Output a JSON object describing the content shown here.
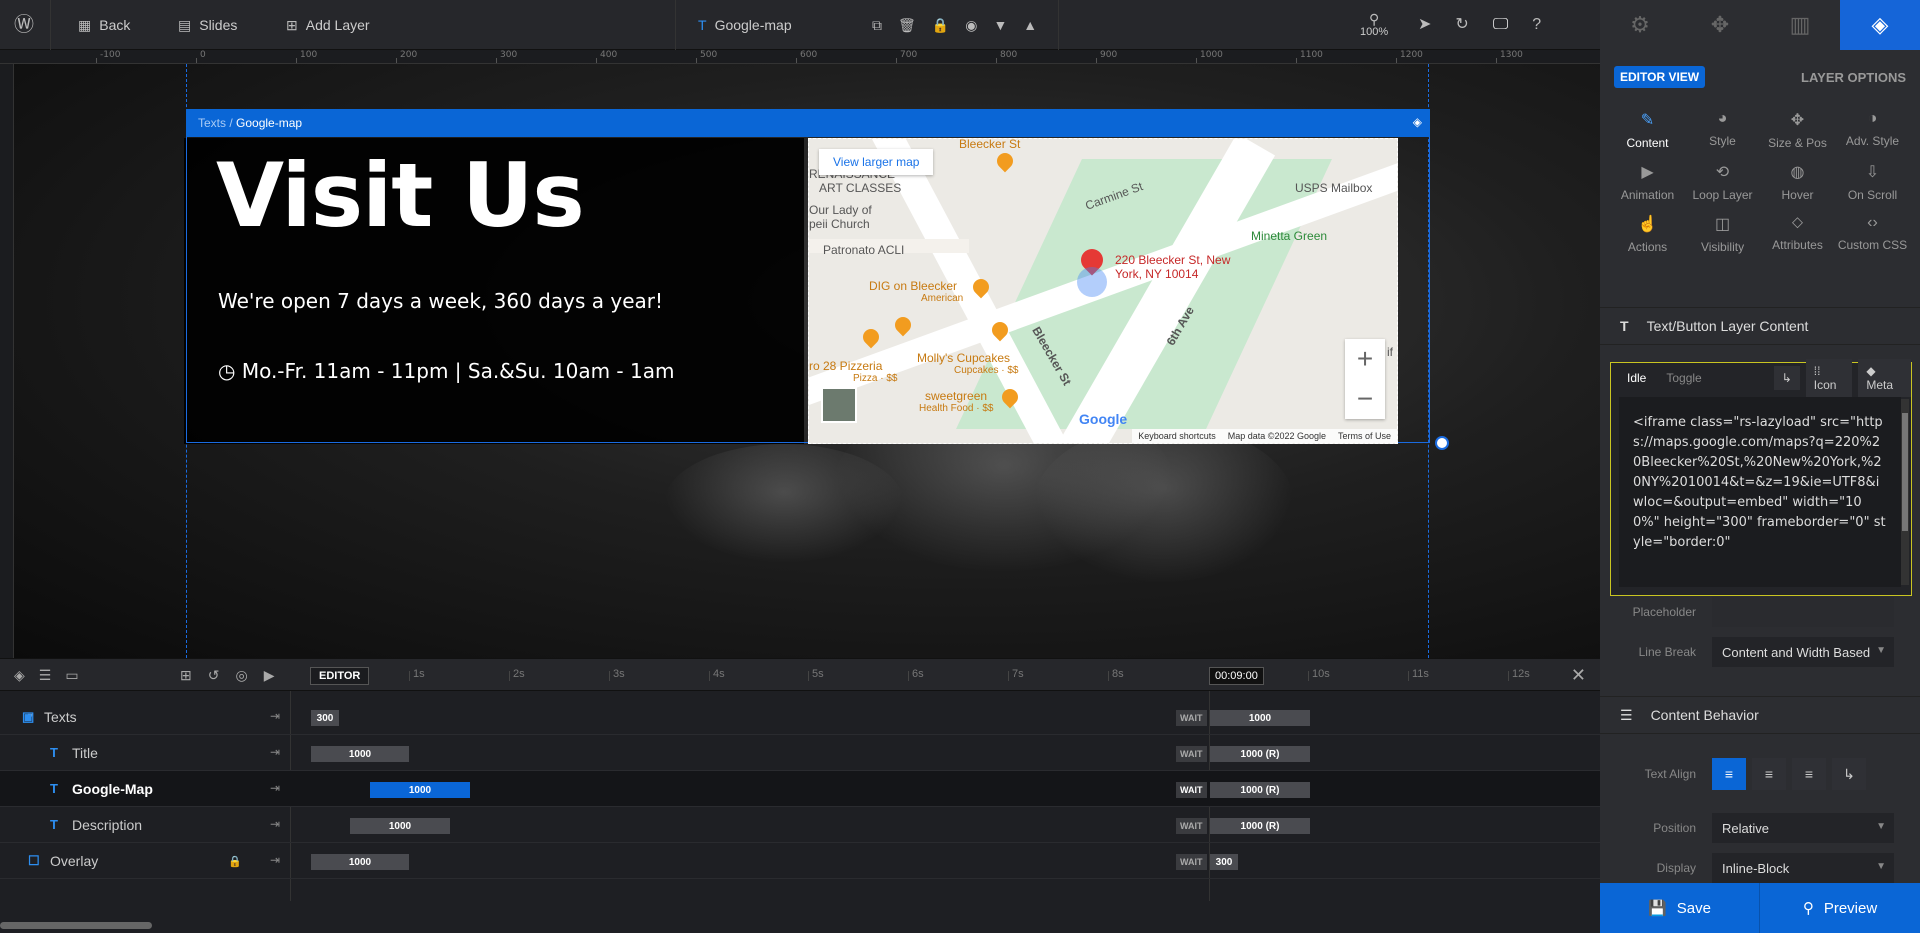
{
  "topbar": {
    "back": "Back",
    "slides": "Slides",
    "add_layer": "Add Layer",
    "layer_name": "Google-map",
    "zoom": "100%"
  },
  "ruler": {
    "labels": [
      "-100",
      "0",
      "100",
      "200",
      "300",
      "400",
      "500",
      "600",
      "700",
      "800",
      "900",
      "1000",
      "1100",
      "1200",
      "1300"
    ]
  },
  "canvas": {
    "breadcrumb_prefix": "Texts /",
    "breadcrumb_current": "Google-map",
    "title": "Visit Us",
    "open_text": "We're open 7 days a week, 360 days a year!",
    "hours_text": "Mo.-Fr. 11am - 11pm  |  Sa.&Su. 10am - 1am"
  },
  "map": {
    "view_larger": "View larger map",
    "labels": {
      "bleecker_top": "Bleecker St",
      "renaissance": "RENAISSANCE",
      "art_classes": "ART CLASSES",
      "lady": "Our Lady of",
      "church": "peii Church",
      "patronato": "Patronato ACLI",
      "carmine": "Carmine St",
      "usps": "USPS Mailbox",
      "minetta": "Minetta Green",
      "address1": "220 Bleecker St, New",
      "address2": "York, NY 10014",
      "dig": "DIG on Bleecker",
      "american": "American",
      "sixth": "6th Ave",
      "bleecker_diag": "Bleecker St",
      "pizzeria": "ro 28 Pizzeria",
      "pizza": "Pizza · $$",
      "mollys": "Molly's Cupcakes",
      "cupcakes": "Cupcakes · $$",
      "sweetgreen": "sweetgreen",
      "health": "Health Food · $$",
      "if": "if"
    },
    "google": "Google",
    "footer": [
      "Keyboard shortcuts",
      "Map data ©2022 Google",
      "Terms of Use"
    ]
  },
  "panel": {
    "editor_view": "EDITOR VIEW",
    "layer_options": "LAYER OPTIONS",
    "options": [
      {
        "label": "Content",
        "icon": "✎"
      },
      {
        "label": "Style",
        "icon": "◕"
      },
      {
        "label": "Size & Pos",
        "icon": "✥"
      },
      {
        "label": "Adv. Style",
        "icon": "◑"
      },
      {
        "label": "Animation",
        "icon": "▶"
      },
      {
        "label": "Loop Layer",
        "icon": "⟲"
      },
      {
        "label": "Hover",
        "icon": "◍"
      },
      {
        "label": "On Scroll",
        "icon": "⇩"
      },
      {
        "label": "Actions",
        "icon": "☝"
      },
      {
        "label": "Visibility",
        "icon": "◫"
      },
      {
        "label": "Attributes",
        "icon": "⬦"
      },
      {
        "label": "Custom CSS",
        "icon": "‹›"
      }
    ],
    "section_content": "Text/Button Layer Content",
    "tabs": {
      "idle": "Idle",
      "toggle": "Toggle",
      "icon": "Icon",
      "meta": "Meta"
    },
    "code": "<iframe class=\"rs-lazyload\" src=\"https://maps.google.com/maps?q=220%20Bleecker%20St,%20New%20York,%20NY%2010014&t=&z=19&ie=UTF8&iwloc=&output=embed\" width=\"100%\" height=\"300\" frameborder=\"0\" style=\"border:0\"",
    "placeholder_label": "Placeholder",
    "linebreak_label": "Line Break",
    "linebreak_value": "Content and Width Based",
    "section_behavior": "Content Behavior",
    "text_align_label": "Text Align",
    "position_label": "Position",
    "position_value": "Relative",
    "display_label": "Display",
    "display_value": "Inline-Block",
    "save": "Save",
    "preview": "Preview"
  },
  "timeline": {
    "editor": "EDITOR",
    "time": "00:09:00",
    "ticks": [
      "1s",
      "2s",
      "3s",
      "4s",
      "5s",
      "6s",
      "7s",
      "8s",
      "10s",
      "11s",
      "12s"
    ],
    "rows": [
      {
        "name": "Texts",
        "bar": "300",
        "wait": "WAIT",
        "waitv": "1000"
      },
      {
        "name": "Title",
        "bar": "1000",
        "wait": "WAIT",
        "waitv": "1000 (R)"
      },
      {
        "name": "Google-Map",
        "bar": "1000",
        "wait": "WAIT",
        "waitv": "1000 (R)"
      },
      {
        "name": "Description",
        "bar": "1000",
        "wait": "WAIT",
        "waitv": "1000 (R)"
      },
      {
        "name": "Overlay",
        "bar": "1000",
        "wait": "WAIT",
        "waitv": "300"
      }
    ]
  },
  "colors": {
    "accent": "#0a66d6",
    "highlight": "#c9c521"
  }
}
